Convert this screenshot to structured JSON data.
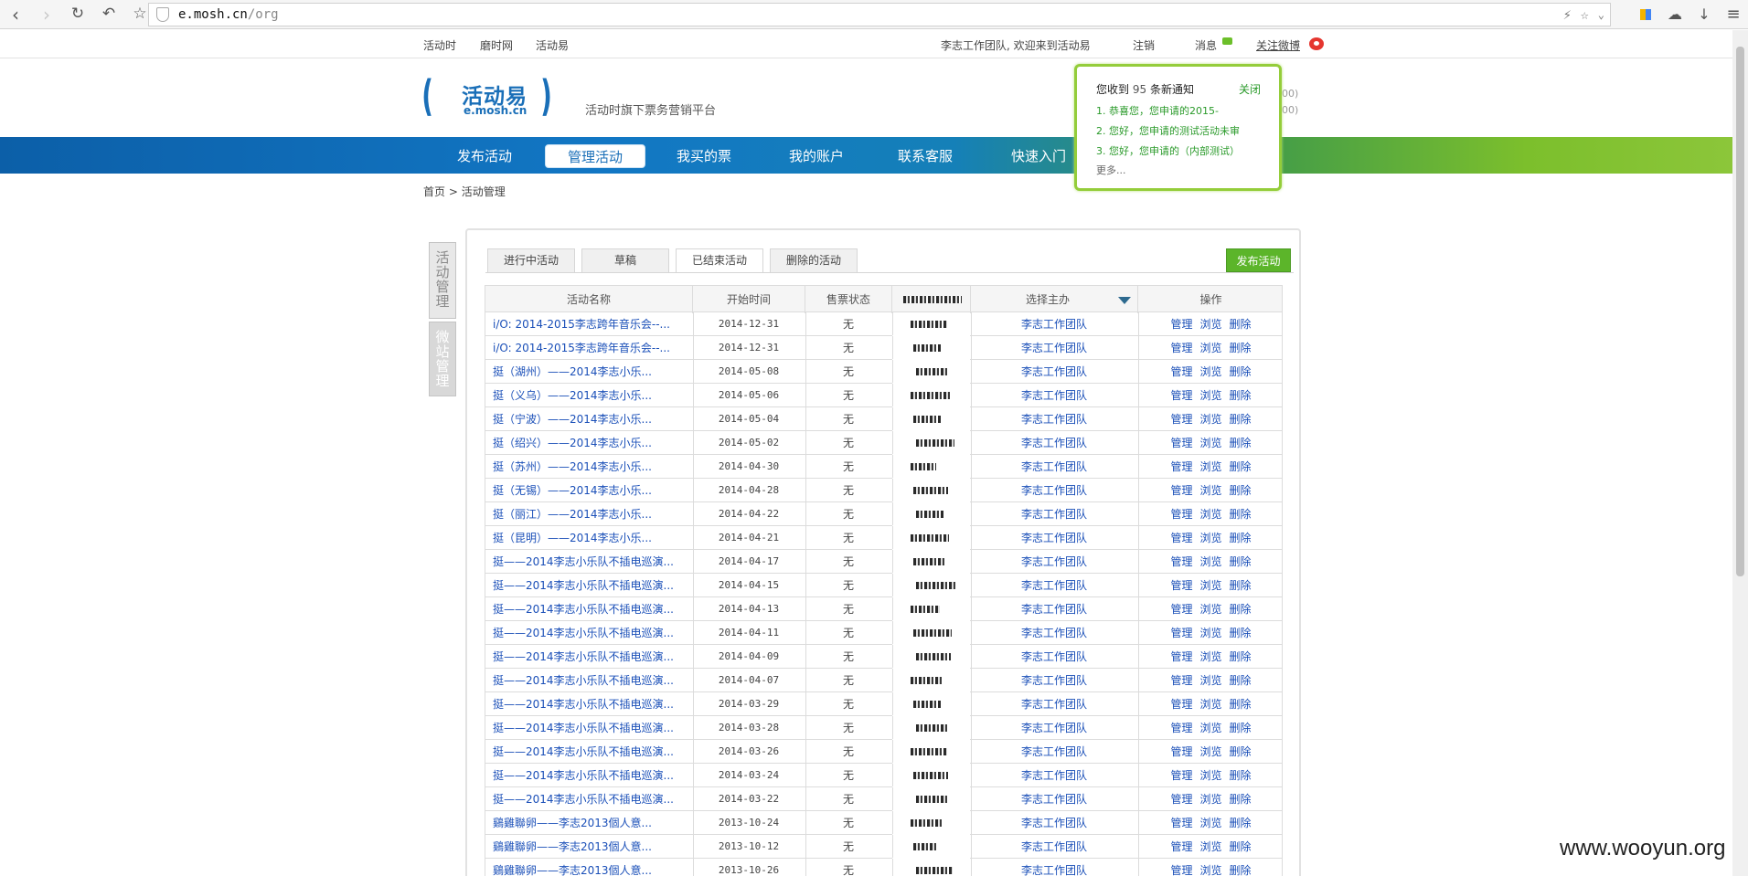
{
  "browser": {
    "host": "e.mosh.cn",
    "path": "/org"
  },
  "toplinks": {
    "link1": "活动时",
    "link2": "磨时网",
    "link3": "活动易",
    "welcome": "李志工作团队, 欢迎来到活动易",
    "logout": "注销",
    "messages": "消息",
    "follow": "关注微博"
  },
  "header": {
    "logo_name": "活动易",
    "logo_domain": "e.mosh.cn",
    "slogan": "活动时旗下票务营销平台"
  },
  "nav": {
    "items": [
      "发布活动",
      "管理活动",
      "我买的票",
      "我的账户",
      "联系客服",
      "快速入门"
    ],
    "active": "管理活动"
  },
  "breadcrumb": {
    "home": "首页",
    "sep": ">",
    "current": "活动管理"
  },
  "side_tabs": {
    "tab1": "活动管理",
    "tab2": "微站管理"
  },
  "tabs": {
    "items": [
      "进行中活动",
      "草稿",
      "已结束活动",
      "删除的活动"
    ],
    "active": "已结束活动"
  },
  "publish_button": "发布活动",
  "table": {
    "headers": {
      "name": "活动名称",
      "start": "开始时间",
      "status": "售票状态",
      "organizer": "选择主办",
      "ops": "操作"
    },
    "ops": [
      "管理",
      "浏览",
      "删除"
    ],
    "rows": [
      {
        "name": "i/O: 2014-2015李志跨年音乐会--...",
        "date": "2014-12-31",
        "status": "无",
        "org": "李志工作团队"
      },
      {
        "name": "i/O: 2014-2015李志跨年音乐会--...",
        "date": "2014-12-31",
        "status": "无",
        "org": "李志工作团队"
      },
      {
        "name": "挺（湖州）——2014李志小乐...",
        "date": "2014-05-08",
        "status": "无",
        "org": "李志工作团队"
      },
      {
        "name": "挺（义乌）——2014李志小乐...",
        "date": "2014-05-06",
        "status": "无",
        "org": "李志工作团队"
      },
      {
        "name": "挺（宁波）——2014李志小乐...",
        "date": "2014-05-04",
        "status": "无",
        "org": "李志工作团队"
      },
      {
        "name": "挺（绍兴）——2014李志小乐...",
        "date": "2014-05-02",
        "status": "无",
        "org": "李志工作团队"
      },
      {
        "name": "挺（苏州）——2014李志小乐...",
        "date": "2014-04-30",
        "status": "无",
        "org": "李志工作团队"
      },
      {
        "name": "挺（无锡）——2014李志小乐...",
        "date": "2014-04-28",
        "status": "无",
        "org": "李志工作团队"
      },
      {
        "name": "挺（丽江）——2014李志小乐...",
        "date": "2014-04-22",
        "status": "无",
        "org": "李志工作团队"
      },
      {
        "name": "挺（昆明）——2014李志小乐...",
        "date": "2014-04-21",
        "status": "无",
        "org": "李志工作团队"
      },
      {
        "name": "挺——2014李志小乐队不插电巡演...",
        "date": "2014-04-17",
        "status": "无",
        "org": "李志工作团队"
      },
      {
        "name": "挺——2014李志小乐队不插电巡演...",
        "date": "2014-04-15",
        "status": "无",
        "org": "李志工作团队"
      },
      {
        "name": "挺——2014李志小乐队不插电巡演...",
        "date": "2014-04-13",
        "status": "无",
        "org": "李志工作团队"
      },
      {
        "name": "挺——2014李志小乐队不插电巡演...",
        "date": "2014-04-11",
        "status": "无",
        "org": "李志工作团队"
      },
      {
        "name": "挺——2014李志小乐队不插电巡演...",
        "date": "2014-04-09",
        "status": "无",
        "org": "李志工作团队"
      },
      {
        "name": "挺——2014李志小乐队不插电巡演...",
        "date": "2014-04-07",
        "status": "无",
        "org": "李志工作团队"
      },
      {
        "name": "挺——2014李志小乐队不插电巡演...",
        "date": "2014-03-29",
        "status": "无",
        "org": "李志工作团队"
      },
      {
        "name": "挺——2014李志小乐队不插电巡演...",
        "date": "2014-03-28",
        "status": "无",
        "org": "李志工作团队"
      },
      {
        "name": "挺——2014李志小乐队不插电巡演...",
        "date": "2014-03-26",
        "status": "无",
        "org": "李志工作团队"
      },
      {
        "name": "挺——2014李志小乐队不插电巡演...",
        "date": "2014-03-24",
        "status": "无",
        "org": "李志工作团队"
      },
      {
        "name": "挺——2014李志小乐队不插电巡演...",
        "date": "2014-03-22",
        "status": "无",
        "org": "李志工作团队"
      },
      {
        "name": "鷄雞聯卵——李志2013個人意...",
        "date": "2013-10-24",
        "status": "无",
        "org": "李志工作团队"
      },
      {
        "name": "鷄雞聯卵——李志2013個人意...",
        "date": "2013-10-12",
        "status": "无",
        "org": "李志工作团队"
      },
      {
        "name": "鷄雞聯卵——李志2013個人意...",
        "date": "2013-10-26",
        "status": "无",
        "org": "李志工作团队"
      }
    ]
  },
  "notification": {
    "prefix": "您收到",
    "count": "95",
    "suffix": "条新通知",
    "close": "关闭",
    "items": [
      "1. 恭喜您，您申请的2015-",
      "2. 您好，您申请的测试活动未审",
      "3. 您好，您申请的（内部测试）"
    ],
    "more": "更多...",
    "behind1": "00)",
    "behind2": "00)"
  },
  "watermark": "www.wooyun.org"
}
